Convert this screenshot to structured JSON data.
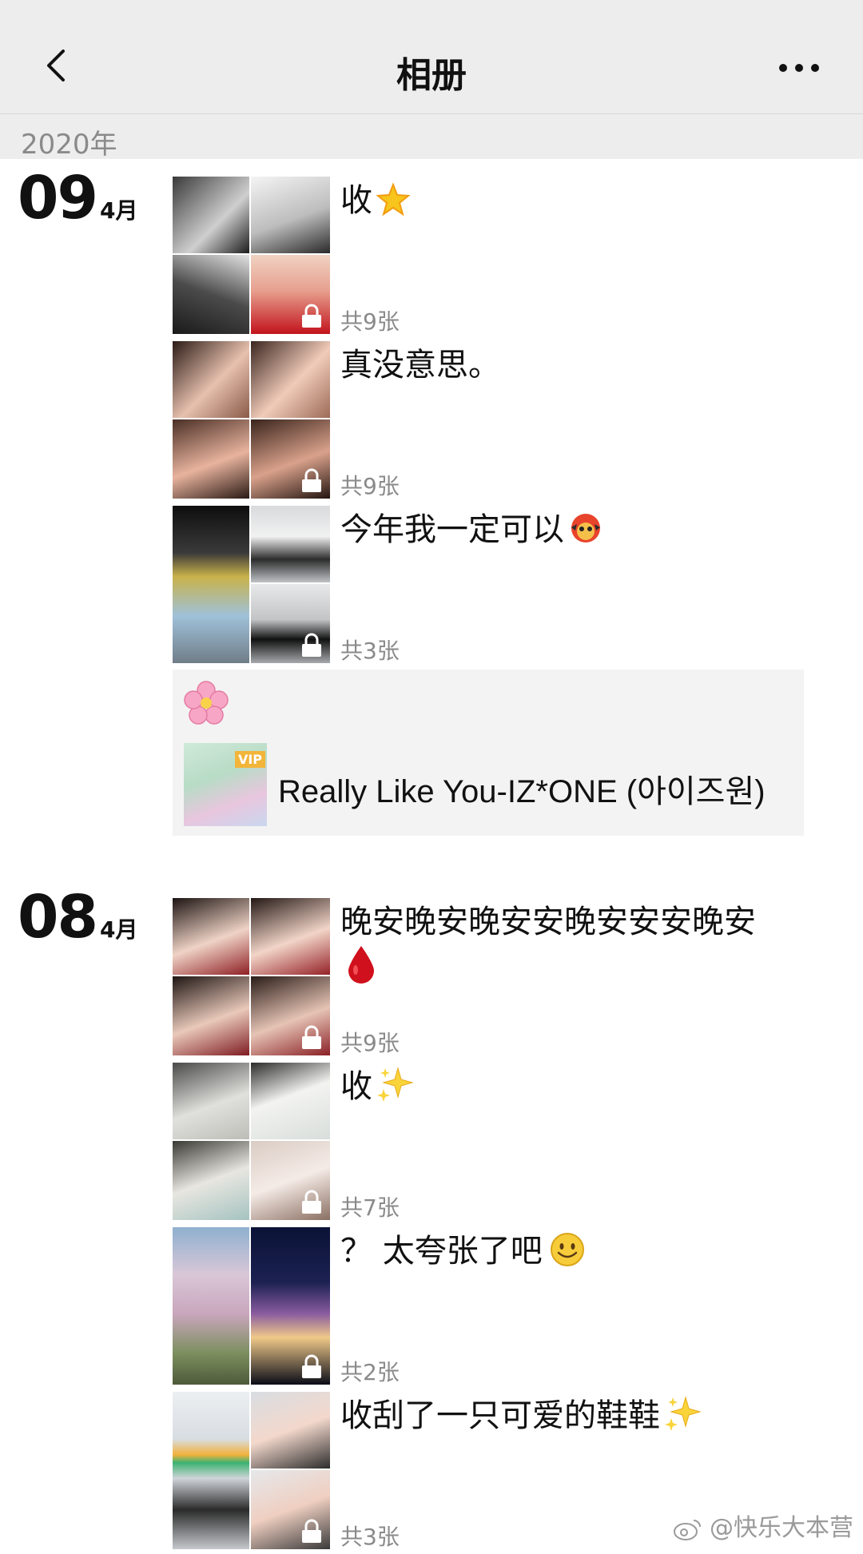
{
  "header": {
    "title": "相册"
  },
  "year_label": "2020年",
  "sections": [
    {
      "day": "09",
      "month": "4月"
    },
    {
      "day": "08",
      "month": "4月"
    }
  ],
  "posts": [
    {
      "caption": "收",
      "count": "共9张",
      "emoji": "star-icon"
    },
    {
      "caption": "真没意思。",
      "count": "共9张"
    },
    {
      "caption": "今年我一定可以",
      "count": "共3张",
      "emoji": "emoji-icon"
    },
    {
      "caption": "晚安晚安晚安安晚安安安晚安",
      "count": "共9张",
      "emoji": "blood-drop-icon"
    },
    {
      "caption": "收",
      "count": "共7张",
      "emoji": "sparkles-icon"
    },
    {
      "caption": "？ 太夸张了吧",
      "count": "共2张",
      "emoji": "smile-icon"
    },
    {
      "caption": "收刮了一只可爱的鞋鞋",
      "count": "共3张",
      "emoji": "sparkles-icon"
    }
  ],
  "music": {
    "title": "Really Like You-IZ*ONE (아이즈원)",
    "badge": "VIP",
    "emoji": "cherry-blossom-icon"
  },
  "watermark": "@快乐大本营"
}
